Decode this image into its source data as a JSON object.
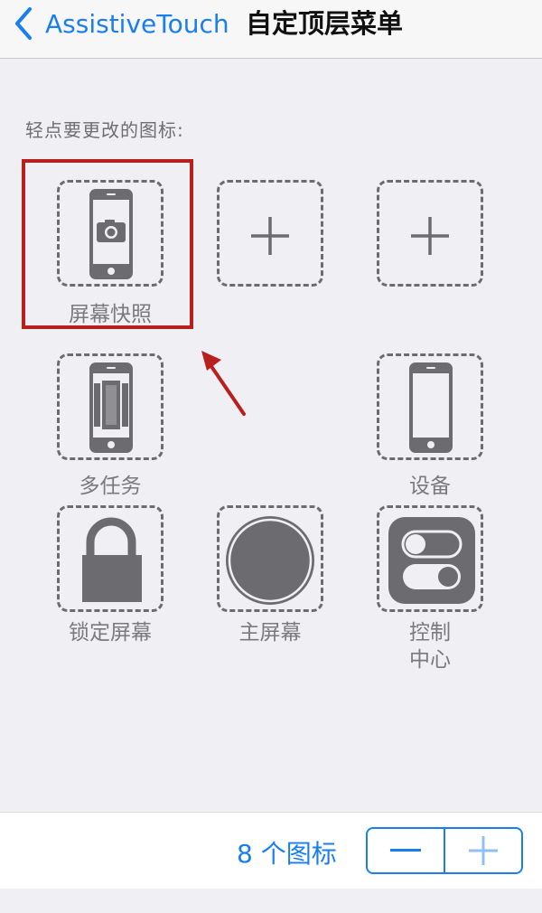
{
  "nav": {
    "back_label": "AssistiveTouch",
    "title": "自定顶层菜单"
  },
  "section": {
    "label": "轻点要更改的图标:"
  },
  "slots": [
    {
      "label": "屏幕快照",
      "icon": "screenshot-icon",
      "highlighted": true
    },
    {
      "label": "",
      "icon": "plus-icon"
    },
    {
      "label": "",
      "icon": "plus-icon"
    },
    {
      "label": "多任务",
      "icon": "multitasking-icon"
    },
    {
      "label": "设备",
      "icon": "device-icon"
    },
    {
      "label": "锁定屏幕",
      "icon": "lock-icon"
    },
    {
      "label": "主屏幕",
      "icon": "home-icon"
    },
    {
      "label": "控制\n中心",
      "icon": "control-center-icon"
    }
  ],
  "footer": {
    "count_label": "8 个图标"
  },
  "colors": {
    "accent": "#1a7ef0",
    "highlight": "#b8201e",
    "icon_gray": "#6b6b70"
  }
}
